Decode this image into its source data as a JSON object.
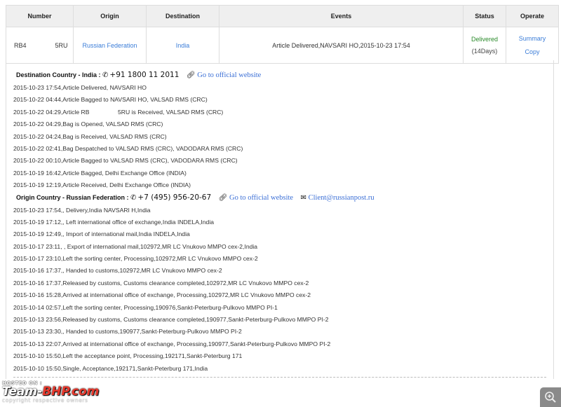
{
  "table": {
    "headers": [
      "Number",
      "Origin",
      "Destination",
      "Events",
      "Status",
      "Operate"
    ],
    "row": {
      "number_prefix": "RB4",
      "number_suffix": "5RU",
      "origin": "Russian Federation",
      "destination": "India",
      "event": "Article Delivered,NAVSARI HO,2015-10-23 17:54",
      "status": "Delivered",
      "days": "(14Days)",
      "operate": [
        "Summary",
        "Copy"
      ]
    }
  },
  "destination": {
    "label": "Destination Country - India :",
    "phone_icon": "phone-icon",
    "phone": "+91 1800 11 2011",
    "link_icon": "link-icon",
    "website_label": "Go to official website",
    "events": [
      "2015-10-23 17:54,Article Delivered, NAVSARI HO",
      "2015-10-22 04:44,Article Bagged to NAVSARI HO, VALSAD RMS (CRC)",
      "2015-10-22 04:29,Article RB                 5RU is Received, VALSAD RMS (CRC)",
      "2015-10-22 04:29,Bag is Opened, VALSAD RMS (CRC)",
      "2015-10-22 04:24,Bag is Received, VALSAD RMS (CRC)",
      "2015-10-22 02:41,Bag Despatched to VALSAD RMS (CRC), VADODARA RMS (CRC)",
      "2015-10-22 00:10,Article Bagged to VALSAD RMS (CRC), VADODARA RMS (CRC)",
      "2015-10-19 16:42,Article Bagged, Delhi Exchange Office (INDIA)",
      "2015-10-19 12:19,Article Received, Delhi Exchange Office (INDIA)"
    ]
  },
  "origin": {
    "label": "Origin Country - Russian Federation :",
    "phone_icon": "phone-icon",
    "phone": "+7 (495) 956-20-67",
    "link_icon": "link-icon",
    "website_label": "Go to official website",
    "mail_icon": "envelope-icon",
    "email": "Client@russianpost.ru",
    "events": [
      "2015-10-23 17:54,, Delivery,India NAVSARI H,India",
      "2015-10-19 17:12,, Left international office of exchange,India INDELA,India",
      "2015-10-19 12:49,, Import of international mail,India INDELA,India",
      "2015-10-17 23:11, , Export of international mail,102972,MR LC Vnukovo MMPO cex-2,India",
      "2015-10-17 23:10,Left the sorting center, Processing,102972,MR LC Vnukovo MMPO cex-2",
      "2015-10-16 17:37,, Handed to customs,102972,MR LC Vnukovo MMPO cex-2",
      "2015-10-16 17:37,Released by customs, Customs clearance completed,102972,MR LC Vnukovo MMPO cex-2",
      "2015-10-16 15:28,Arrived at international office of exchange, Processing,102972,MR LC Vnukovo MMPO cex-2",
      "2015-10-14 02:57,Left the sorting center, Processing,190976,Sankt-Peterburg-Pulkovo MMPO PI-1",
      "2015-10-13 23:56,Released by customs, Customs clearance completed,190977,Sankt-Peterburg-Pulkovo MMPO PI-2",
      "2015-10-13 23:30,, Handed to customs,190977,Sankt-Peterburg-Pulkovo MMPO PI-2",
      "2015-10-13 22:07,Arrived at international office of exchange, Processing,190977,Sankt-Peterburg-Pulkovo MMPO PI-2",
      "2015-10-10 15:50,Left the acceptance point, Processing,192171,Sankt-Peterburg 171",
      "2015-10-10 15:50,Single, Acceptance,192171,Sankt-Peterburg 171,India"
    ]
  },
  "watermark": {
    "hosted": "HOSTED ON :",
    "brand_white": "Team-",
    "brand_red": "BHP.com",
    "copyright": "copyright respective owners"
  },
  "zoom_icon": "zoom-in-icon"
}
